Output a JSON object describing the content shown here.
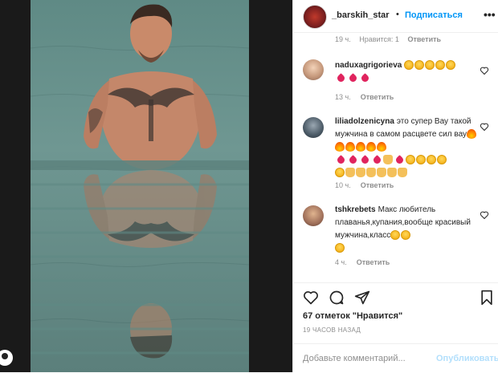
{
  "header": {
    "username": "_barskih_star",
    "separator": "•",
    "follow_label": "Подписаться",
    "more_label": "•••"
  },
  "previous_comment_meta": {
    "time": "19 ч.",
    "likes": "Нравится: 1",
    "reply": "Ответить"
  },
  "comments": [
    {
      "username": "naduxagrigorieva",
      "text": "",
      "time": "13 ч.",
      "reply": "Ответить"
    },
    {
      "username": "liliadolzenicyna",
      "text": "это супер Вау такой мужчина в самом расцвете сил вау",
      "time": "10 ч.",
      "reply": "Ответить"
    },
    {
      "username": "tshkrebets",
      "text": "Макс любитель плаванья,купания,вообще красивый мужчина,класс",
      "time": "4 ч.",
      "reply": "Ответить"
    }
  ],
  "likes_text": "67 отметок \"Нравится\"",
  "post_time": "19 ЧАСОВ НАЗАД",
  "add_comment": {
    "placeholder": "Добавьте комментарий...",
    "publish_label": "Опубликовать"
  },
  "colors": {
    "link": "#0095f6",
    "publish_disabled": "#b2dffc",
    "heart_emoji": "#e0245e"
  }
}
